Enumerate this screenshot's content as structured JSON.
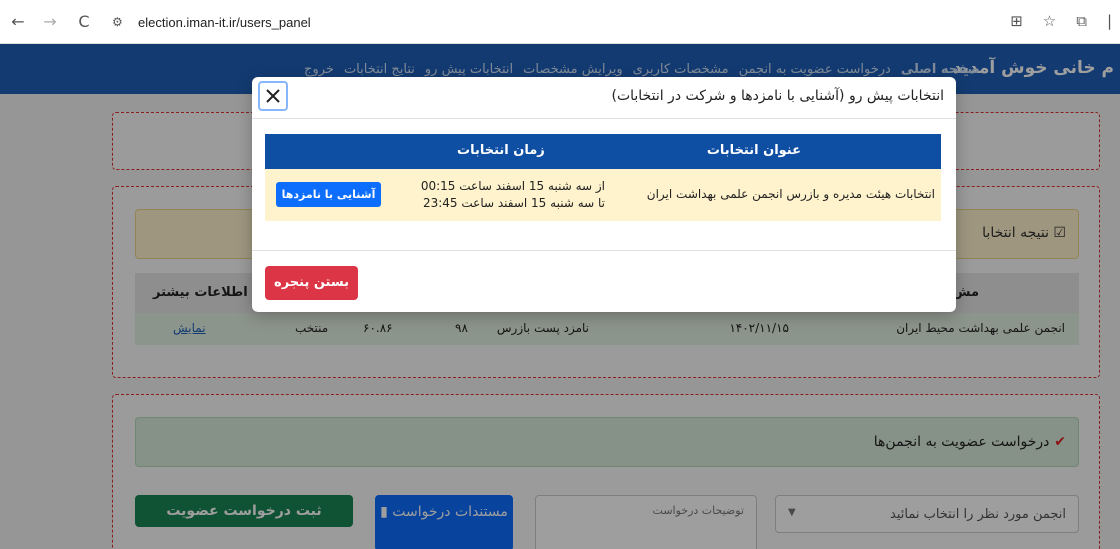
{
  "browser": {
    "url": "election.iman-it.ir/users_panel"
  },
  "header": {
    "welcome": "م خانی خوش آمدید",
    "menu": [
      "صفحه اصلی",
      "درخواست عضویت به انجمن",
      "مشخصات کاربری",
      "ویرایش مشخصات",
      "انتخابات پیش رو",
      "نتایج انتخابات",
      "خروج"
    ]
  },
  "results_section": {
    "alert": "نتیجه انتخابا",
    "columns": [
      "مش",
      "اطلاعات بیشتر"
    ],
    "row": {
      "association": "انجمن علمی بهداشت محیط ایران",
      "date": "۱۴۰۲/۱۱/۱۵",
      "position": "نامزد پست بازرس",
      "votes": "۹۸",
      "percent": "۶۰.۸۶",
      "status": "منتخب",
      "link": "نمایش"
    }
  },
  "membership_section": {
    "alert": "درخواست عضویت به انجمن‌ها",
    "submit_button": "ثبت درخواست عضویت",
    "documents_button": "مستندات درخواست",
    "description_placeholder": "توضیحات درخواست",
    "select_placeholder": "انجمن مورد نظر را انتخاب نمائید"
  },
  "modal": {
    "title": "انتخابات پیش رو (آشنایی با نامزدها و شرکت در انتخابات)",
    "columns": {
      "title": "عنوان انتخابات",
      "time": "زمان انتخابات"
    },
    "rows": [
      {
        "title": "انتخابات هیئت مدیره و بازرس انجمن علمی بهداشت ایران",
        "from": "از سه شنبه 15 اسفند ساعت 00:15",
        "to": "تا سه شنبه 15 اسفند ساعت 23:45",
        "button": "آشنایی با نامزدها"
      }
    ],
    "close_window_button": "بستن پنجره"
  }
}
